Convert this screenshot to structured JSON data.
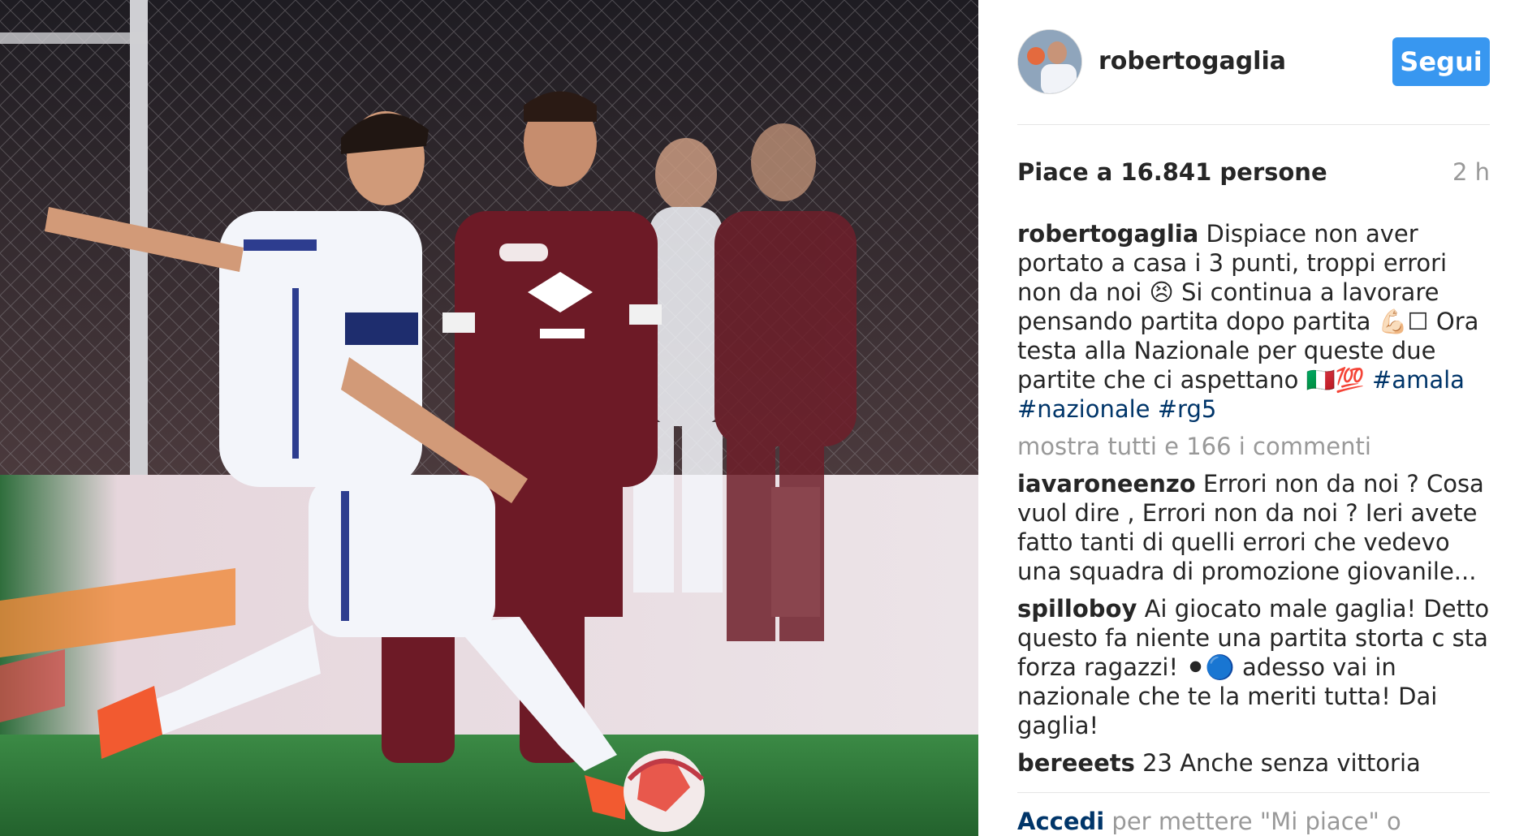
{
  "post": {
    "image_description_icon": "photo-icon"
  },
  "header": {
    "username": "robertogaglia",
    "follow_label": "Segui",
    "follow_color": "#3897f0"
  },
  "meta": {
    "likes": "Piace a 16.841 persone",
    "time": "2 h"
  },
  "caption": {
    "author": "robertogaglia",
    "text_1": "Dispiace non aver portato a casa i 3 punti, troppi errori non da noi ",
    "emoji_1": "😣",
    "text_2": " Si continua a lavorare pensando partita dopo partita ",
    "emoji_2": "💪🏻",
    "emoji_box": "☐",
    "text_3": " Ora testa alla Nazionale per queste due partite che ci aspettano ",
    "emoji_3": "🇮🇹💯",
    "tag_1": "#amala",
    "tag_2": "#nazionale",
    "tag_3": "#rg5"
  },
  "show_all_comments": "mostra tutti e 166 i commenti",
  "comments": [
    {
      "author": "iavaroneenzo",
      "text": "Errori non da noi ? Cosa vuol dire , Errori non da noi ? Ieri avete fatto tanti di quelli errori che vedevo una squadra di promozione giovanile..."
    },
    {
      "author": "spilloboy",
      "text_1": "Ai giocato male gaglia! Detto questo fa niente una partita storta c sta forza ragazzi! ",
      "emoji": "⚫🔵",
      "text_2": " adesso vai in nazionale che te la meriti tutta! Dai gaglia!"
    },
    {
      "author": "bereeets",
      "text": "23 Anche senza vittoria"
    }
  ],
  "footer": {
    "login_label": "Accedi",
    "rest_text": " per mettere \"Mi piace\" o",
    "link_color": "#003569"
  }
}
